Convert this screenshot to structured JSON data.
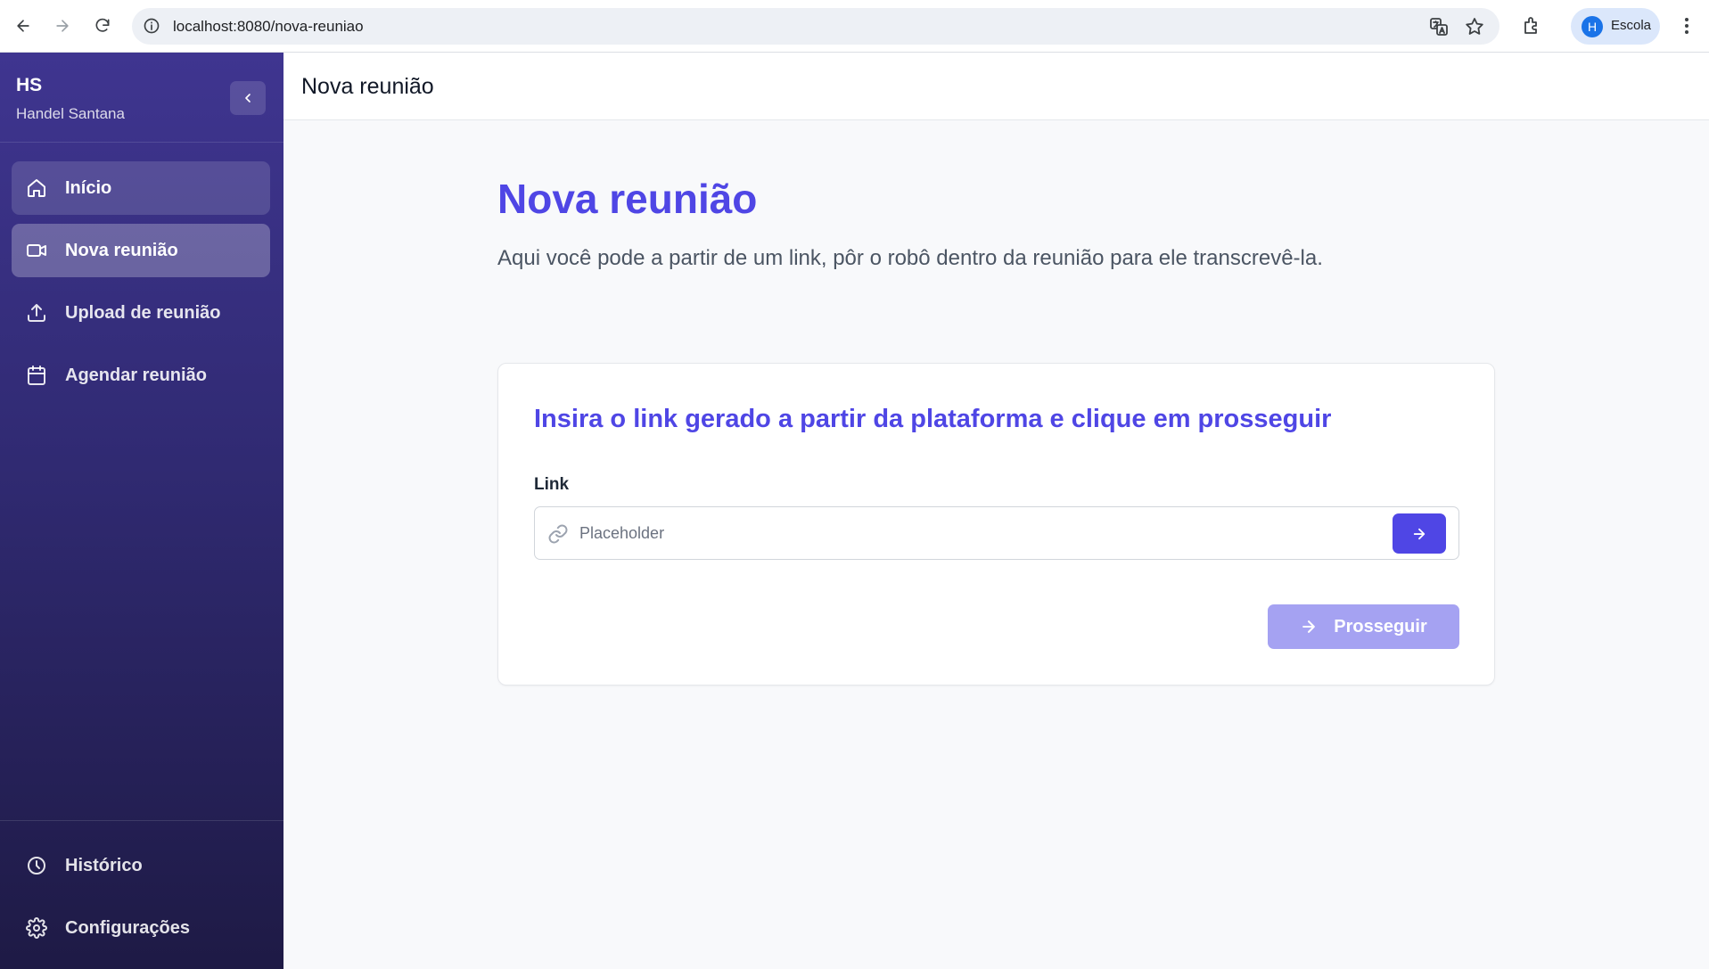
{
  "browser": {
    "url": "localhost:8080/nova-reuniao",
    "profile_initial": "H",
    "profile_name": "Escola"
  },
  "sidebar": {
    "initials": "HS",
    "username": "Handel Santana",
    "items": [
      {
        "label": "Início",
        "icon": "home-icon"
      },
      {
        "label": "Nova reunião",
        "icon": "video-icon"
      },
      {
        "label": "Upload de reunião",
        "icon": "upload-icon"
      },
      {
        "label": "Agendar reunião",
        "icon": "calendar-icon"
      }
    ],
    "footer_items": [
      {
        "label": "Histórico",
        "icon": "clock-icon"
      },
      {
        "label": "Configurações",
        "icon": "gear-icon"
      }
    ]
  },
  "header": {
    "title": "Nova reunião"
  },
  "main": {
    "title": "Nova reunião",
    "description": "Aqui você pode a partir de um link, pôr o robô dentro da reunião para ele transcrevê-la.",
    "card": {
      "title": "Insira o link gerado a partir da plataforma e clique em prosseguir",
      "field_label": "Link",
      "field_placeholder": "Placeholder",
      "field_value": "",
      "proceed_label": "Prosseguir"
    }
  },
  "colors": {
    "accent": "#4f46e5",
    "accent_disabled": "#a5a2f2",
    "sidebar_top": "#3f3590",
    "sidebar_bottom": "#1e1a45"
  }
}
